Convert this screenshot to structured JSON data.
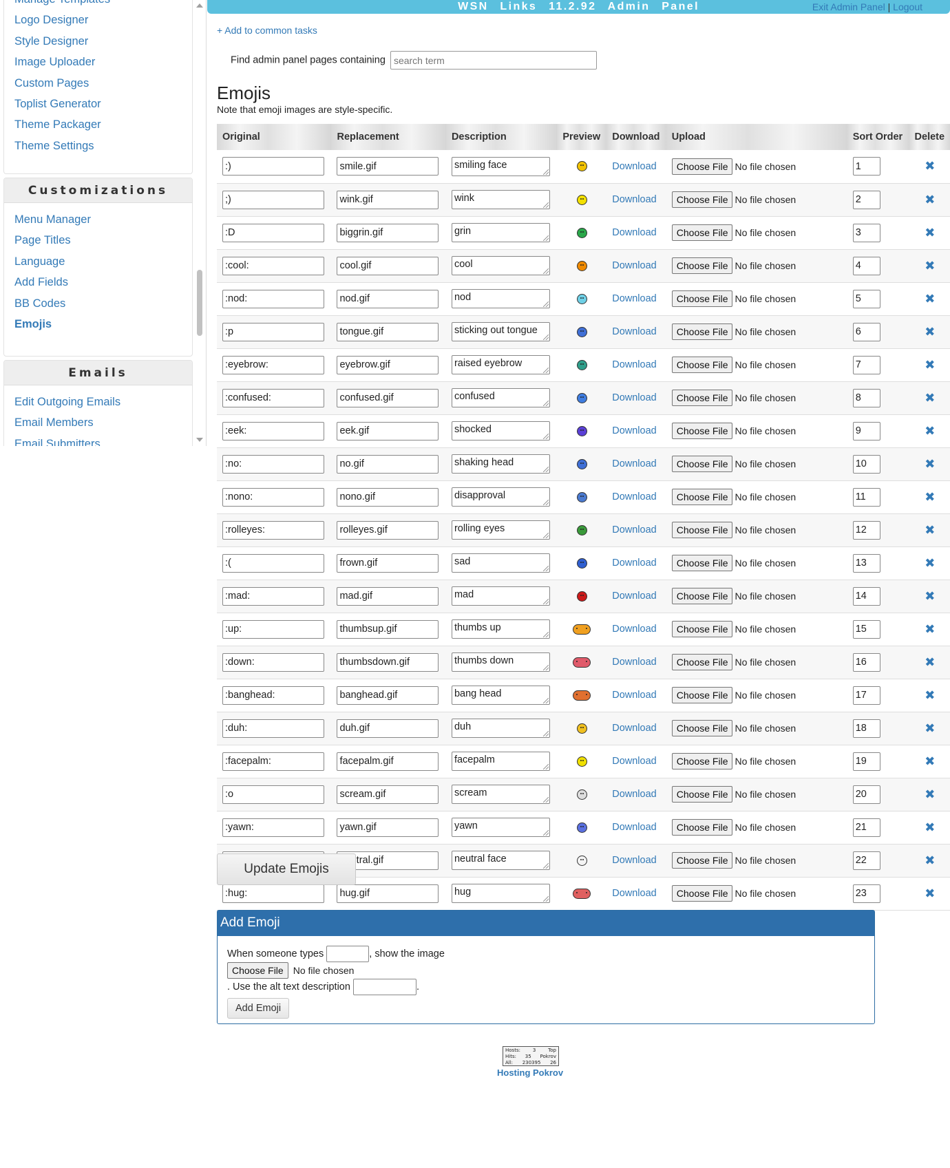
{
  "sidebar": {
    "box1": {
      "items": [
        {
          "label": "Manage Templates"
        },
        {
          "label": "Logo Designer"
        },
        {
          "label": "Style Designer"
        },
        {
          "label": "Image Uploader"
        },
        {
          "label": "Custom Pages"
        },
        {
          "label": "Toplist Generator"
        },
        {
          "label": "Theme Packager"
        },
        {
          "label": "Theme Settings"
        }
      ]
    },
    "customizations": {
      "heading": "Customizations",
      "items": [
        {
          "label": "Menu Manager"
        },
        {
          "label": "Page Titles"
        },
        {
          "label": "Language"
        },
        {
          "label": "Add Fields"
        },
        {
          "label": "BB Codes"
        },
        {
          "label": "Emojis",
          "active": true
        }
      ]
    },
    "emails": {
      "heading": "Emails",
      "items": [
        {
          "label": "Edit Outgoing Emails"
        },
        {
          "label": "Email Members"
        },
        {
          "label": "Email Submitters"
        }
      ]
    }
  },
  "header": {
    "title": "WSN Links 11.2.92 Admin Panel",
    "exit_label": "Exit Admin Panel",
    "separator": "|",
    "logout_label": "Logout"
  },
  "add_common_label": "+ Add to common tasks",
  "find": {
    "label": "Find admin panel pages containing",
    "placeholder": "search term"
  },
  "page": {
    "title": "Emojis",
    "note": "Note that emoji images are style-specific."
  },
  "table": {
    "columns": {
      "original": "Original",
      "replacement": "Replacement",
      "description": "Description",
      "preview": "Preview",
      "download": "Download",
      "upload": "Upload",
      "sort_order": "Sort Order",
      "delete": "Delete"
    },
    "download_label": "Download",
    "choose_file_label": "Choose File",
    "no_file_label": "No file chosen",
    "rows": [
      {
        "original": ":)",
        "replacement": "smile.gif",
        "description": "smiling face",
        "sort": "1",
        "color": "#f2c200",
        "icon": "smile-emoji-icon"
      },
      {
        "original": ";)",
        "replacement": "wink.gif",
        "description": "wink",
        "sort": "2",
        "color": "#f3e000",
        "icon": "wink-emoji-icon"
      },
      {
        "original": ":D",
        "replacement": "biggrin.gif",
        "description": "grin",
        "sort": "3",
        "color": "#2aa84a",
        "icon": "grin-emoji-icon"
      },
      {
        "original": ":cool:",
        "replacement": "cool.gif",
        "description": "cool",
        "sort": "4",
        "color": "#f08a00",
        "icon": "cool-emoji-icon"
      },
      {
        "original": ":nod:",
        "replacement": "nod.gif",
        "description": "nod",
        "sort": "5",
        "color": "#6fd0e6",
        "icon": "nod-emoji-icon"
      },
      {
        "original": ":p",
        "replacement": "tongue.gif",
        "description": "sticking out tongue",
        "sort": "6",
        "color": "#3f6fd6",
        "icon": "tongue-emoji-icon"
      },
      {
        "original": ":eyebrow:",
        "replacement": "eyebrow.gif",
        "description": "raised eyebrow",
        "sort": "7",
        "color": "#2f9e8a",
        "icon": "eyebrow-emoji-icon"
      },
      {
        "original": ":confused:",
        "replacement": "confused.gif",
        "description": "confused",
        "sort": "8",
        "color": "#3f7de0",
        "icon": "confused-emoji-icon"
      },
      {
        "original": ":eek:",
        "replacement": "eek.gif",
        "description": "shocked",
        "sort": "9",
        "color": "#5a3fd6",
        "icon": "eek-emoji-icon"
      },
      {
        "original": ":no:",
        "replacement": "no.gif",
        "description": "shaking head",
        "sort": "10",
        "color": "#3f6fd6",
        "icon": "no-emoji-icon"
      },
      {
        "original": ":nono:",
        "replacement": "nono.gif",
        "description": "disapproval",
        "sort": "11",
        "color": "#4a7ad0",
        "icon": "nono-emoji-icon"
      },
      {
        "original": ":rolleyes:",
        "replacement": "rolleyes.gif",
        "description": "rolling eyes",
        "sort": "12",
        "color": "#3a9a3a",
        "icon": "rolleyes-emoji-icon"
      },
      {
        "original": ":(",
        "replacement": "frown.gif",
        "description": "sad",
        "sort": "13",
        "color": "#2f5fd0",
        "icon": "frown-emoji-icon"
      },
      {
        "original": ":mad:",
        "replacement": "mad.gif",
        "description": "mad",
        "sort": "14",
        "color": "#cc1a1a",
        "icon": "mad-emoji-icon"
      },
      {
        "original": ":up:",
        "replacement": "thumbsup.gif",
        "description": "thumbs up",
        "sort": "15",
        "color": "#f0a020",
        "icon": "thumbs-up-emoji-icon"
      },
      {
        "original": ":down:",
        "replacement": "thumbsdown.gif",
        "description": "thumbs down",
        "sort": "16",
        "color": "#e05a6a",
        "icon": "thumbs-down-emoji-icon"
      },
      {
        "original": ":banghead:",
        "replacement": "banghead.gif",
        "description": "bang head",
        "sort": "17",
        "color": "#e07030",
        "icon": "banghead-emoji-icon"
      },
      {
        "original": ":duh:",
        "replacement": "duh.gif",
        "description": "duh",
        "sort": "18",
        "color": "#f0c020",
        "icon": "duh-emoji-icon"
      },
      {
        "original": ":facepalm:",
        "replacement": "facepalm.gif",
        "description": "facepalm",
        "sort": "19",
        "color": "#f0e000",
        "icon": "facepalm-emoji-icon"
      },
      {
        "original": ":o",
        "replacement": "scream.gif",
        "description": "scream",
        "sort": "20",
        "color": "#dddddd",
        "icon": "scream-emoji-icon"
      },
      {
        "original": ":yawn:",
        "replacement": "yawn.gif",
        "description": "yawn",
        "sort": "21",
        "color": "#5a70e0",
        "icon": "yawn-emoji-icon"
      },
      {
        "original": ":|",
        "replacement": "neutral.gif",
        "description": "neutral face",
        "sort": "22",
        "color": "#f4f4f4",
        "icon": "neutral-emoji-icon"
      },
      {
        "original": ":hug:",
        "replacement": "hug.gif",
        "description": "hug",
        "sort": "23",
        "color": "#e06060",
        "icon": "hug-emoji-icon"
      }
    ]
  },
  "update_button_label": "Update Emojis",
  "add_emoji": {
    "heading": "Add Emoji",
    "text_before": "When someone types",
    "text_show": ", show the image",
    "choose_file_label": "Choose File",
    "no_file_label": "No file chosen",
    "text_alt": ". Use the alt text description",
    "text_end": ".",
    "button_label": "Add Emoji"
  },
  "footer": {
    "counter": {
      "hosts_label": "Hosts:",
      "hosts_value": "3",
      "top_label": "Top",
      "hits_label": "Hits:",
      "hits_value": "35",
      "pokrov_label": "Pokrov",
      "all_label": "All:",
      "all_value": "230395",
      "rank_value": "26"
    },
    "hosting_label": "Hosting Pokrov"
  },
  "colors": {
    "topbar": "#5bc0de",
    "link": "#337ab7",
    "add_box_header": "#2e6fab"
  }
}
